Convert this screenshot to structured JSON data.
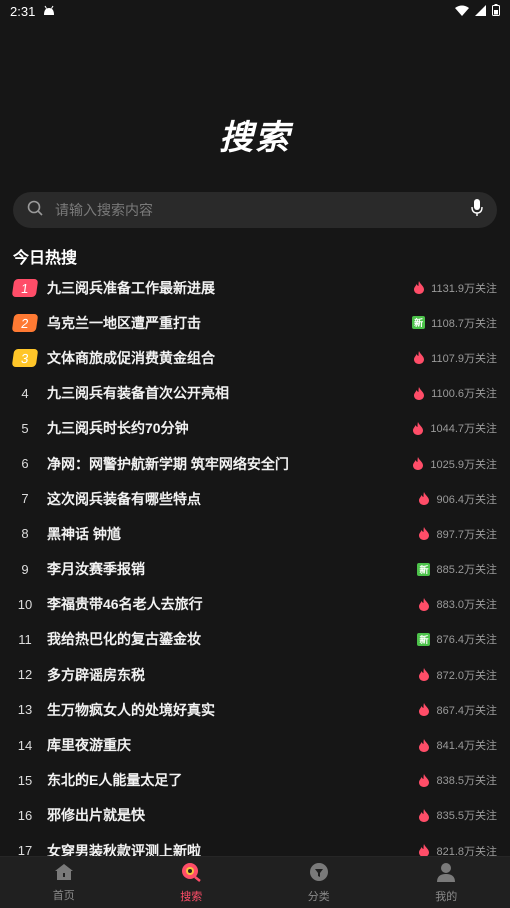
{
  "status": {
    "time": "2:31"
  },
  "page_title": "搜索",
  "search": {
    "placeholder": "请输入搜索内容"
  },
  "section_title": "今日热搜",
  "colors": {
    "rank1": "#ff4d68",
    "rank2": "#ff7a33",
    "rank3": "#ffc629",
    "flame": "#ff4d68",
    "new_badge": "#4cc24a",
    "active_tab": "#ff4d68"
  },
  "hot_items": [
    {
      "rank": "1",
      "title": "九三阅兵准备工作最新进展",
      "count": "1131.9万关注",
      "tag": "flame"
    },
    {
      "rank": "2",
      "title": "乌克兰一地区遭严重打击",
      "count": "1108.7万关注",
      "tag": "new"
    },
    {
      "rank": "3",
      "title": "文体商旅成促消费黄金组合",
      "count": "1107.9万关注",
      "tag": "flame"
    },
    {
      "rank": "4",
      "title": "九三阅兵有装备首次公开亮相",
      "count": "1100.6万关注",
      "tag": "flame"
    },
    {
      "rank": "5",
      "title": "九三阅兵时长约70分钟",
      "count": "1044.7万关注",
      "tag": "flame"
    },
    {
      "rank": "6",
      "title": "净网：网警护航新学期 筑牢网络安全门",
      "count": "1025.9万关注",
      "tag": "flame"
    },
    {
      "rank": "7",
      "title": "这次阅兵装备有哪些特点",
      "count": "906.4万关注",
      "tag": "flame"
    },
    {
      "rank": "8",
      "title": "黑神话 钟馗",
      "count": "897.7万关注",
      "tag": "flame"
    },
    {
      "rank": "9",
      "title": "李月汝赛季报销",
      "count": "885.2万关注",
      "tag": "new"
    },
    {
      "rank": "10",
      "title": "李福贵带46名老人去旅行",
      "count": "883.0万关注",
      "tag": "flame"
    },
    {
      "rank": "11",
      "title": "我给热巴化的复古鎏金妆",
      "count": "876.4万关注",
      "tag": "new"
    },
    {
      "rank": "12",
      "title": "多方辟谣房东税",
      "count": "872.0万关注",
      "tag": "flame"
    },
    {
      "rank": "13",
      "title": "生万物疯女人的处境好真实",
      "count": "867.4万关注",
      "tag": "flame"
    },
    {
      "rank": "14",
      "title": "库里夜游重庆",
      "count": "841.4万关注",
      "tag": "flame"
    },
    {
      "rank": "15",
      "title": "东北的E人能量太足了",
      "count": "838.5万关注",
      "tag": "flame"
    },
    {
      "rank": "16",
      "title": "邪修出片就是快",
      "count": "835.5万关注",
      "tag": "flame"
    },
    {
      "rank": "17",
      "title": "女穿男装秋款评测上新啦",
      "count": "821.8万关注",
      "tag": "flame"
    }
  ],
  "new_badge_label": "新",
  "tabs": [
    {
      "label": "首页",
      "icon": "home-icon"
    },
    {
      "label": "搜索",
      "icon": "search-tab-icon"
    },
    {
      "label": "分类",
      "icon": "category-icon"
    },
    {
      "label": "我的",
      "icon": "profile-icon"
    }
  ]
}
